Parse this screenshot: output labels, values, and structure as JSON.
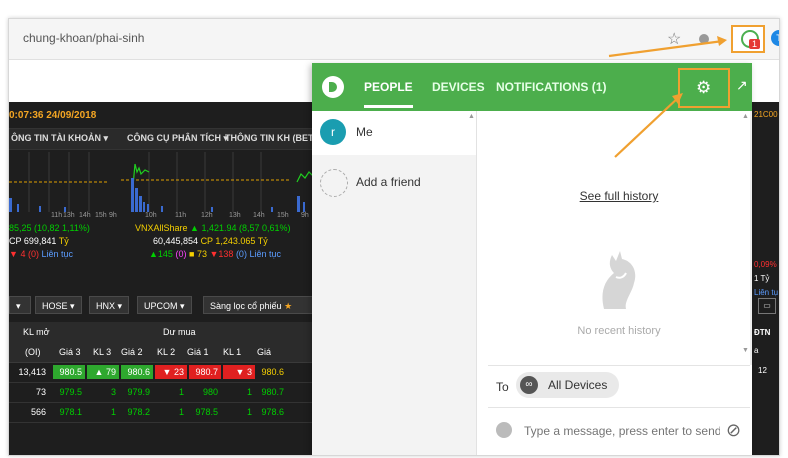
{
  "browser": {
    "url": "chung-khoan/phai-sinh",
    "ext_badge": "1",
    "profile_initial": "T"
  },
  "trading": {
    "time": "0:07:36",
    "date": "24/09/2018",
    "menu": [
      "ÔNG TIN TÀI KHOẢN ▾",
      "CÔNG CỤ PHÂN TÍCH ▾",
      "THÔNG TIN KH (BETA)"
    ],
    "axis_a": [
      "11h",
      "13h",
      "14h",
      "15h",
      "9h"
    ],
    "axis_b": [
      "10h",
      "11h",
      "12h",
      "13h",
      "14h",
      "15h"
    ],
    "axis_c": "9h",
    "idx1": {
      "l1": "85,25 (10,82 1,11%)",
      "l2a": "CP 699,841",
      "l2b": "Tỷ",
      "l3a": "4 (0)",
      "l3b": "Liên tục"
    },
    "idx2": {
      "name": "VNXAllShare",
      "val": "1,421.94 (8,57 0,61%)",
      "vol": "60,445,854",
      "cp": "CP 1,243.065",
      "ty": "Tỷ",
      "up": "145",
      "ref": "(0)",
      "mid": "73",
      "dn": "138",
      "ceil": "(0)",
      "state": "Liên tục"
    },
    "exchanges": [
      "HOSE ▾",
      "HNX ▾",
      "UPCOM ▾",
      "Sàng lọc cổ phiếu"
    ],
    "th1": {
      "kl_mo": "KL mở",
      "du_mua": "Dư mua"
    },
    "th2": [
      "(OI)",
      "Giá 3",
      "KL 3",
      "Giá 2",
      "KL 2",
      "Giá 1",
      "KL 1",
      "Giá"
    ],
    "rows": [
      [
        "13,413",
        "980.5",
        "79",
        "980.6",
        "23",
        "980.7",
        "3",
        "980.6"
      ],
      [
        "73",
        "979.5",
        "3",
        "979.9",
        "1",
        "980",
        "1",
        "980.7"
      ],
      [
        "566",
        "978.1",
        "1",
        "978.2",
        "1",
        "978.5",
        "1",
        "978.6"
      ]
    ],
    "right_slice": {
      "code": "21C00",
      "pct": "0,09%",
      "ty": "1 Tỷ",
      "state": "Liên tụ",
      "dtn": "ĐTN",
      "a": "a",
      "n": "12"
    }
  },
  "panel": {
    "tabs": [
      "PEOPLE",
      "DEVICES",
      "NOTIFICATIONS (1)"
    ],
    "me": {
      "initial": "r",
      "label": "Me"
    },
    "add_friend": "Add a friend",
    "history_link": "See full history",
    "no_recent": "No recent history",
    "to_label": "To",
    "to_target": "All Devices",
    "message_placeholder": "Type a message, press enter to send",
    "colors": {
      "header": "#4cae4c",
      "highlight": "#f0a030"
    }
  }
}
